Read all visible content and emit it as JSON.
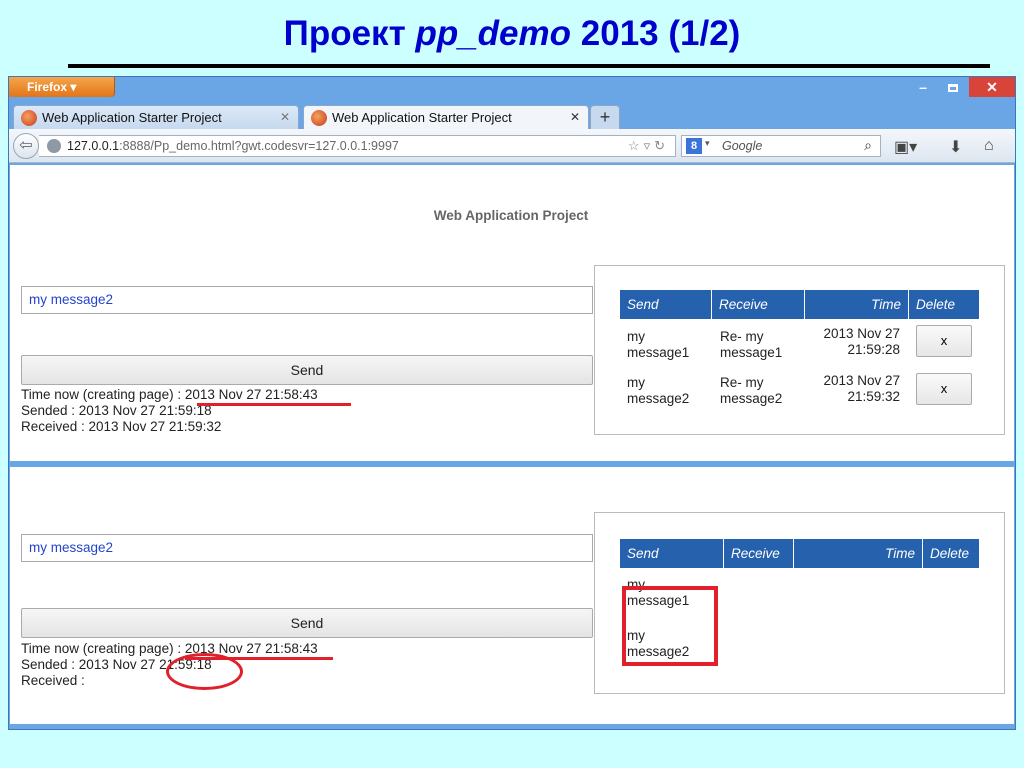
{
  "slide": {
    "title_prefix": "Проект",
    "title_italic": "pp_demo",
    "title_suffix": "2013  (1/2)"
  },
  "browser": {
    "menu_label": "Firefox",
    "window_controls": {
      "minimize": "–",
      "close": "✕"
    },
    "tabs": [
      {
        "title": "Web Application Starter Project",
        "active": false
      },
      {
        "title": "Web Application Starter Project",
        "active": true
      }
    ],
    "new_tab": "+",
    "url_host": "127.0.0.1",
    "url_rest": ":8888/Pp_demo.html?gwt.codesvr=127.0.0.1:9997",
    "search_engine": "8",
    "search_placeholder": "Google",
    "icons": [
      "back-arrow-icon",
      "globe-icon",
      "star-icon",
      "reload-icon",
      "search-icon",
      "bookmarks-icon",
      "download-icon",
      "home-icon"
    ]
  },
  "pane1": {
    "app_title": "Web Application Project",
    "input_value": "my message2",
    "send_label": "Send",
    "time_now": "Time now (creating page) : 2013 Nov 27 21:58:43",
    "sended": "Sended : 2013 Nov 27 21:59:18",
    "received": "Received : 2013 Nov 27 21:59:32",
    "table": {
      "headers": [
        "Send",
        "Receive",
        "Time",
        "Delete"
      ],
      "rows": [
        {
          "send": [
            "my",
            "message1"
          ],
          "receive": [
            "Re- my",
            "message1"
          ],
          "time": [
            "2013 Nov 27",
            "21:59:28"
          ],
          "delete": "x"
        },
        {
          "send": [
            "my",
            "message2"
          ],
          "receive": [
            "Re- my",
            "message2"
          ],
          "time": [
            "2013 Nov 27",
            "21:59:32"
          ],
          "delete": "x"
        }
      ]
    }
  },
  "pane2": {
    "input_value": "my message2",
    "send_label": "Send",
    "time_now": "Time now (creating page) : 2013 Nov 27 21:58:43",
    "sended": "Sended : 2013 Nov 27 21:59:18",
    "received": "Received :",
    "table": {
      "headers": [
        "Send",
        "Receive",
        "Time",
        "Delete"
      ],
      "rows": [
        {
          "send": [
            "my",
            "message1"
          ]
        },
        {
          "send": [
            "my",
            "message2"
          ]
        }
      ]
    }
  },
  "annotation_color": "#e0202a"
}
